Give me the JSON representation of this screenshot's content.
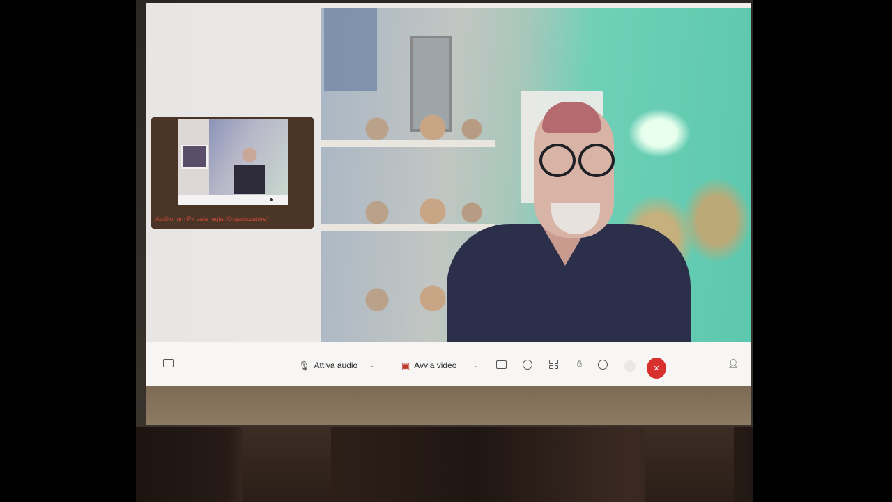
{
  "meeting": {
    "self_view_caption": "Auditorium Pk sala regia (Organizzatore)"
  },
  "toolbar": {
    "chat_icon": "chat-icon",
    "audio_label": "Attiva audio",
    "audio_icon": "microphone-muted-icon",
    "video_label": "Avvia video",
    "video_icon": "camera-off-icon",
    "share_icon": "share-screen-icon",
    "record_icon": "record-icon",
    "layout_icon": "grid-layout-icon",
    "hand_icon": "raise-hand-icon",
    "reactions_icon": "reactions-icon",
    "more_icon": "more-options-icon",
    "leave_icon": "close-icon",
    "participants_icon": "participants-icon"
  },
  "colors": {
    "leave_button": "#d8302f",
    "toolbar_bg": "#f7f6f5",
    "self_view_caption": "#c84a3a"
  }
}
